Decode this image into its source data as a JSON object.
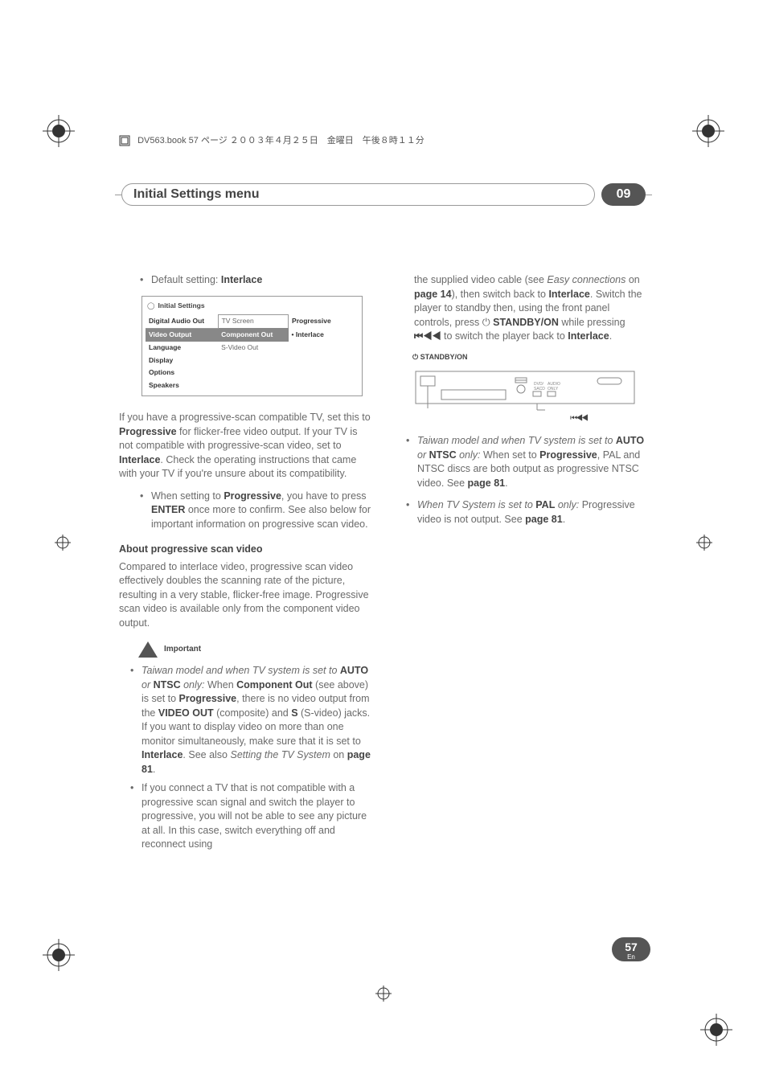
{
  "header_meta": "DV563.book  57 ページ  ２００３年４月２５日　金曜日　午後８時１１分",
  "page_title": "Initial Settings menu",
  "chapter": "09",
  "col1": {
    "default_setting_label": "Default setting:",
    "default_setting_value": "Interlace",
    "panel": {
      "title": "Initial Settings",
      "rows": [
        {
          "c1": "Digital Audio Out",
          "c2": "TV Screen",
          "c3": "Progressive"
        },
        {
          "c1": "Video Output",
          "c2": "Component Out",
          "c3": "Interlace"
        },
        {
          "c1": "Language",
          "c2": "S-Video Out",
          "c3": ""
        },
        {
          "c1": "Display",
          "c2": "",
          "c3": ""
        },
        {
          "c1": "Options",
          "c2": "",
          "c3": ""
        },
        {
          "c1": "Speakers",
          "c2": "",
          "c3": ""
        }
      ]
    },
    "para1_a": "If you have a progressive-scan compatible TV, set this to ",
    "para1_b": "Progressive",
    "para1_c": " for flicker-free video output. If your TV is not compatible with progressive-scan video, set to ",
    "para1_d": "Interlace",
    "para1_e": ". Check the operating instructions that came with your TV if you're unsure about its compatibility.",
    "sub1_a": "When setting to ",
    "sub1_b": "Progressive",
    "sub1_c": ", you have to press ",
    "sub1_d": "ENTER",
    "sub1_e": " once more to confirm. See also below for important information on progressive scan video.",
    "subhead": "About progressive scan video",
    "para2": "Compared to interlace video, progressive scan video effectively doubles the scanning rate of the picture, resulting in a very stable, flicker-free image. Progressive scan video is available only from the component video output.",
    "important_label": "Important",
    "imp1_a": "Taiwan model and when TV system is set to ",
    "imp1_b": "AUTO",
    "imp1_c": " or ",
    "imp1_d": "NTSC",
    "imp1_e": " only:",
    "imp1_f": " When ",
    "imp1_g": "Component Out",
    "imp1_h": " (see above) is set to ",
    "imp1_i": "Progressive",
    "imp1_j": ", there is no video output from the ",
    "imp1_k": "VIDEO OUT",
    "imp1_l": " (composite) and ",
    "imp1_m": "S",
    "imp1_n": " (S-video) jacks. If you want to display video on more than one monitor simultaneously, make sure that it is set to ",
    "imp1_o": "Interlace",
    "imp1_p": ". See also ",
    "imp1_q": "Setting the TV System",
    "imp1_r": " on ",
    "imp1_s": "page 81",
    "imp1_t": ".",
    "imp2": "If you connect a TV that is not compatible with a progressive scan signal and switch the player to progressive, you will not be able to see any picture at all. In this case, switch everything off and reconnect using"
  },
  "col2": {
    "cont_a": "the supplied video cable (see ",
    "cont_b": "Easy connections",
    "cont_c": " on ",
    "cont_d": "page 14",
    "cont_e": "), then switch back to ",
    "cont_f": "Interlace",
    "cont_g": ". Switch the player to standby then, using the front panel controls, press ",
    "cont_h": " STANDBY/ON",
    "cont_i": " while pressing ",
    "cont_j": " to switch the player back to ",
    "cont_k": "Interlace",
    "cont_l": ".",
    "diagram_top": " STANDBY/ON",
    "diagram_bot": "⏮◀◀",
    "b1_a": "Taiwan model and when TV system is set to ",
    "b1_b": "AUTO",
    "b1_c": " or ",
    "b1_d": "NTSC",
    "b1_e": " only:",
    "b1_f": " When set to ",
    "b1_g": "Progressive",
    "b1_h": ", PAL and NTSC discs are both output as progressive NTSC video. See ",
    "b1_i": "page 81",
    "b1_j": ".",
    "b2_a": "When TV System is set to ",
    "b2_b": "PAL",
    "b2_c": " only:",
    "b2_d": " Progressive video is not output. See ",
    "b2_e": "page 81",
    "b2_f": "."
  },
  "page_num": "57",
  "page_lang": "En"
}
